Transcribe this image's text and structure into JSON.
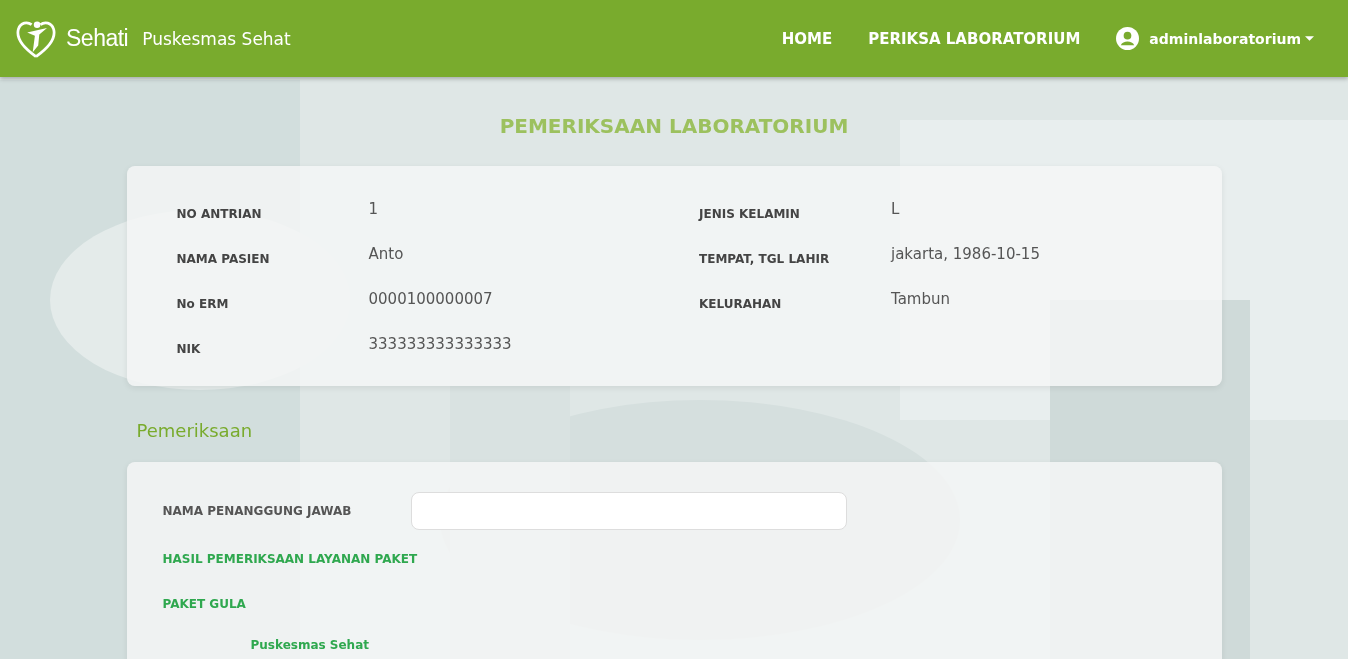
{
  "navbar": {
    "brand_logo": "Sehati",
    "brand_name": "Puskesmas Sehat",
    "links": [
      {
        "label": "HOME"
      },
      {
        "label": "PERIKSA LABORATORIUM"
      }
    ],
    "user": "adminlaboratorium"
  },
  "page_title": "PEMERIKSAAN LABORATORIUM",
  "patient": {
    "left": [
      {
        "label": "NO ANTRIAN",
        "value": "1"
      },
      {
        "label": "NAMA PASIEN",
        "value": "Anto"
      },
      {
        "label": "No ERM",
        "value": "0000100000007"
      },
      {
        "label": "NIK",
        "value": "333333333333333"
      }
    ],
    "right": [
      {
        "label": "JENIS KELAMIN",
        "value": "L"
      },
      {
        "label": "TEMPAT, TGL LAHIR",
        "value": "jakarta, 1986-10-15"
      },
      {
        "label": "KELURAHAN",
        "value": "Tambun"
      }
    ]
  },
  "section_title": "Pemeriksaan",
  "form": {
    "responsible_label": "NAMA PENANGGUNG JAWAB",
    "result_heading": "HASIL PEMERIKSAAN LAYANAN PAKET",
    "package": "PAKET GULA",
    "footer_text": "Puskesmas Sehat"
  }
}
